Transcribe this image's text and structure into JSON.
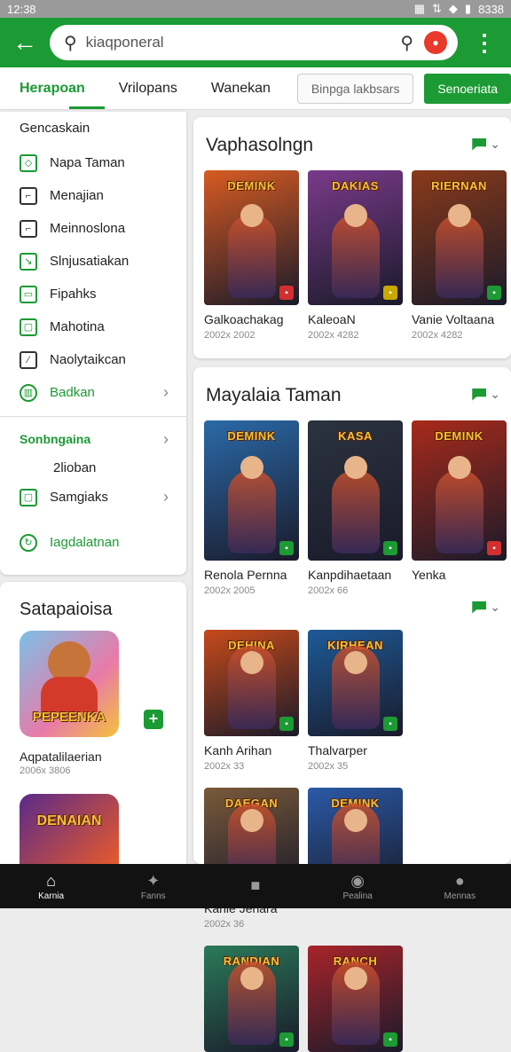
{
  "status": {
    "time": "12:38",
    "right": "8338"
  },
  "search": {
    "value": "kiaqponeral"
  },
  "tabs": [
    "Herapoan",
    "Vrilopans",
    "Wanekan"
  ],
  "tab_search": "Binpga lakbsars",
  "tab_button": "Senoeriata",
  "sidebar": {
    "header": "Gencaskain",
    "items": [
      {
        "label": "Napa Taman"
      },
      {
        "label": "Menajian"
      },
      {
        "label": "Meinnoslona"
      },
      {
        "label": "Slnjusatiakan"
      },
      {
        "label": "Fipahks"
      },
      {
        "label": "Mahotina"
      },
      {
        "label": "Naolytaikcan"
      },
      {
        "label": "Badkan"
      }
    ],
    "sub_head": "Sonbngaina",
    "sub_text": "2lioban",
    "sub_item": "Samgiaks",
    "footer_item": "Iagdalatnan"
  },
  "left_card": {
    "title": "Satapaioisa",
    "game_title": "Aqpatalilaerian",
    "game_meta": "2006x 3806",
    "thumb1_text": "PEPEENKA",
    "thumb2_text": "DENAIAN"
  },
  "section1": {
    "title": "Vaphasolngn",
    "games": [
      {
        "title": "Galkoachakag",
        "meta": "2002x 2002",
        "art": "DEMINK",
        "color": "#d75b22",
        "badge": "#d32f2f"
      },
      {
        "title": "KaleoaN",
        "meta": "2002x 4282",
        "art": "DAKIAS",
        "color": "#7a3a8a",
        "badge": "#c9a800"
      },
      {
        "title": "Vanie Voltaana",
        "meta": "2002x 4282",
        "art": "RIERNAN",
        "color": "#8a3a1a",
        "badge": "#1c9a34"
      }
    ]
  },
  "section2": {
    "title": "Mayalaia Taman",
    "games": [
      {
        "title": "Renola Pernna",
        "meta": "2002x 2005",
        "art": "DEMINK",
        "color": "#2a6aa8",
        "badge": "#1c9a34"
      },
      {
        "title": "Kanpdihaetaan",
        "meta": "2002x 66",
        "art": "KASA",
        "color": "#2b3340",
        "badge": "#1c9a34"
      },
      {
        "title": "Yenka",
        "meta": "",
        "art": "DEMINK",
        "color": "#a82a1a",
        "badge": "#d32f2f"
      }
    ]
  },
  "section3": {
    "games": [
      {
        "title": "Kanh Arihan",
        "meta": "2002x 33",
        "art": "DEHINA",
        "color": "#c74a1a",
        "badge": "#1c9a34"
      },
      {
        "title": "Thalvarper",
        "meta": "2002x 35",
        "art": "KIRHEAN",
        "color": "#1d5a98",
        "badge": "#1c9a34"
      },
      {
        "title": "Kanle Jenara",
        "meta": "2002x 36",
        "art": "DAEGAN",
        "color": "#7a5a3a",
        "badge": "#555555"
      },
      {
        "title": "",
        "meta": "",
        "art": "DEMINK",
        "color": "#2a5aa8",
        "badge": "#1c9a34"
      },
      {
        "title": "",
        "meta": "",
        "art": "RANDIAN",
        "color": "#2a7a5a",
        "badge": "#1c9a34"
      },
      {
        "title": "",
        "meta": "",
        "art": "RANCH",
        "color": "#a8242a",
        "badge": "#1c9a34"
      }
    ]
  },
  "bottom_nav": [
    "Karnia",
    "Fanns",
    "",
    "Pealina",
    "Mennas"
  ]
}
